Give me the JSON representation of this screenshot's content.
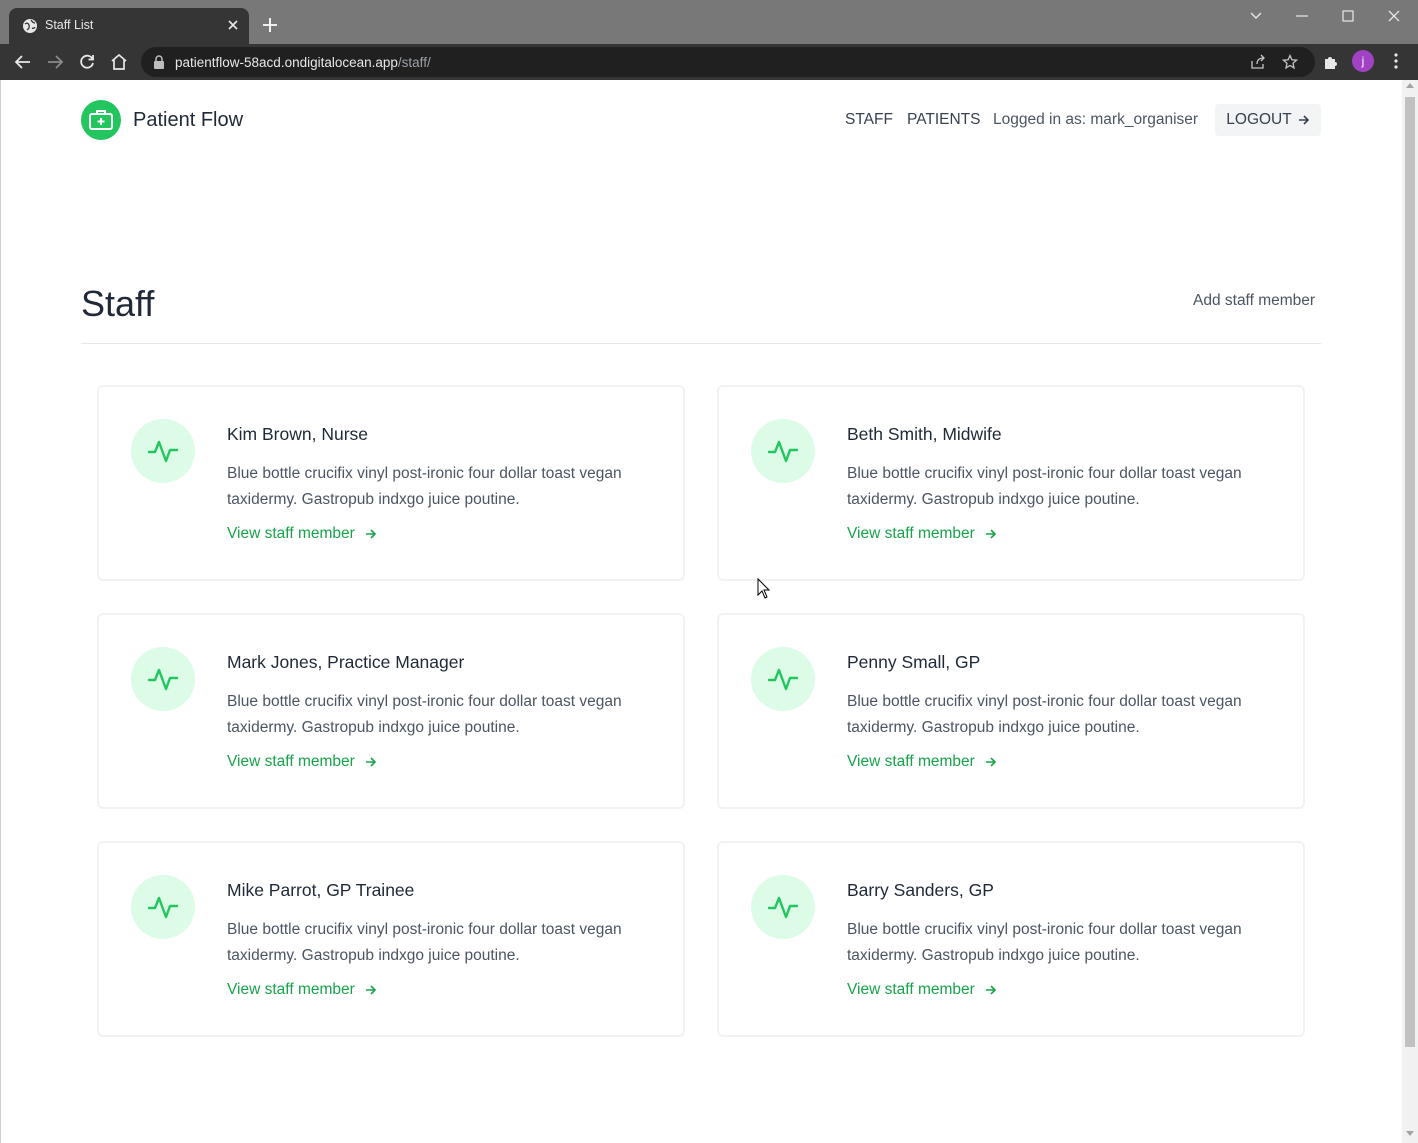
{
  "browser": {
    "tab_title": "Staff List",
    "url_host": "patientflow-58acd.ondigitalocean.app",
    "url_path": "/staff/",
    "profile_initial": "j"
  },
  "header": {
    "brand": "Patient Flow",
    "nav": {
      "staff": "STAFF",
      "patients": "PATIENTS"
    },
    "logged_in": "Logged in as: mark_organiser",
    "logout": "LOGOUT"
  },
  "main": {
    "title": "Staff",
    "add_link": "Add staff member",
    "cards": [
      {
        "name": "Kim Brown, Nurse",
        "description": "Blue bottle crucifix vinyl post-ironic four dollar toast vegan taxidermy. Gastropub indxgo juice poutine.",
        "link": "View staff member"
      },
      {
        "name": "Beth Smith, Midwife",
        "description": "Blue bottle crucifix vinyl post-ironic four dollar toast vegan taxidermy. Gastropub indxgo juice poutine.",
        "link": "View staff member"
      },
      {
        "name": "Mark Jones, Practice Manager",
        "description": "Blue bottle crucifix vinyl post-ironic four dollar toast vegan taxidermy. Gastropub indxgo juice poutine.",
        "link": "View staff member"
      },
      {
        "name": "Penny Small, GP",
        "description": "Blue bottle crucifix vinyl post-ironic four dollar toast vegan taxidermy. Gastropub indxgo juice poutine.",
        "link": "View staff member"
      },
      {
        "name": "Mike Parrot, GP Trainee",
        "description": "Blue bottle crucifix vinyl post-ironic four dollar toast vegan taxidermy. Gastropub indxgo juice poutine.",
        "link": "View staff member"
      },
      {
        "name": "Barry Sanders, GP",
        "description": "Blue bottle crucifix vinyl post-ironic four dollar toast vegan taxidermy. Gastropub indxgo juice poutine.",
        "link": "View staff member"
      }
    ]
  },
  "colors": {
    "accent": "#22c55e",
    "link": "#16a34a",
    "icon_bg": "#dcfce7"
  },
  "icons": {
    "logo": "first-aid-kit-icon",
    "card": "activity-pulse-icon",
    "link_arrow": "arrow-right-icon"
  }
}
